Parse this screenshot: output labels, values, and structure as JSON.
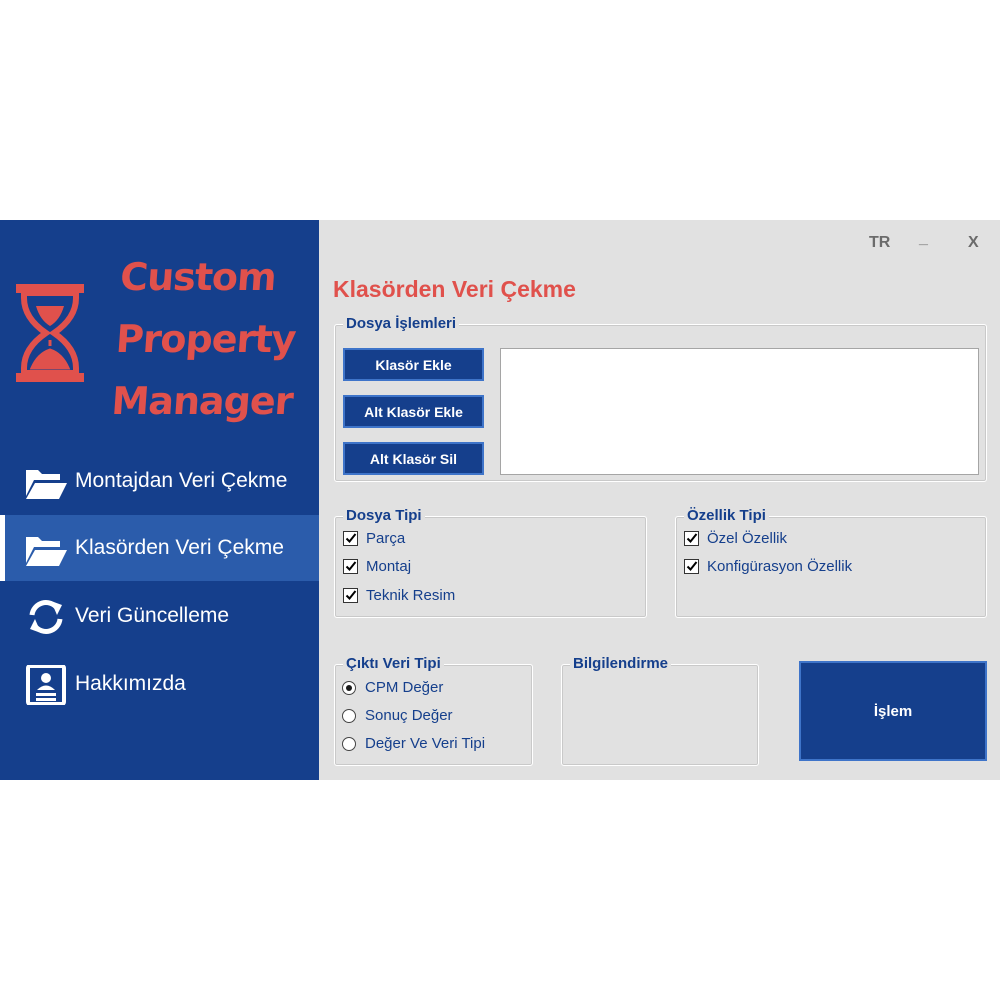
{
  "app": {
    "logo_lines": [
      "Custom",
      "Property",
      "Manager"
    ]
  },
  "sidebar": {
    "items": [
      {
        "label": "Montajdan Veri Çekme",
        "icon": "folder-open-icon",
        "active": false
      },
      {
        "label": "Klasörden Veri Çekme",
        "icon": "folder-open-icon",
        "active": true
      },
      {
        "label": "Veri Güncelleme",
        "icon": "refresh-icon",
        "active": false
      },
      {
        "label": "Hakkımızda",
        "icon": "contact-card-icon",
        "active": false
      }
    ]
  },
  "window_controls": {
    "language": "TR",
    "minimize": "_",
    "close": "X"
  },
  "main": {
    "title": "Klasörden Veri Çekme",
    "file_ops": {
      "title": "Dosya İşlemleri",
      "buttons": [
        "Klasör Ekle",
        "Alt Klasör Ekle",
        "Alt Klasör Sil"
      ]
    },
    "file_type": {
      "title": "Dosya Tipi",
      "options": [
        {
          "label": "Parça",
          "checked": true
        },
        {
          "label": "Montaj",
          "checked": true
        },
        {
          "label": "Teknik Resim",
          "checked": true
        }
      ]
    },
    "property_type": {
      "title": "Özellik Tipi",
      "options": [
        {
          "label": "Özel Özellik",
          "checked": true
        },
        {
          "label": "Konfigürasyon Özellik",
          "checked": true
        }
      ]
    },
    "output_type": {
      "title": "Çıktı Veri Tipi",
      "options": [
        {
          "label": "CPM Değer",
          "selected": true
        },
        {
          "label": "Sonuç Değer",
          "selected": false
        },
        {
          "label": "Değer Ve Veri Tipi",
          "selected": false
        }
      ]
    },
    "info": {
      "title": "Bilgilendirme"
    },
    "process_button": "İşlem"
  },
  "colors": {
    "sidebar": "#153f8c",
    "sidebar_active": "#2b5cab",
    "accent_red": "#e0514c",
    "background": "#e1e1e1"
  }
}
